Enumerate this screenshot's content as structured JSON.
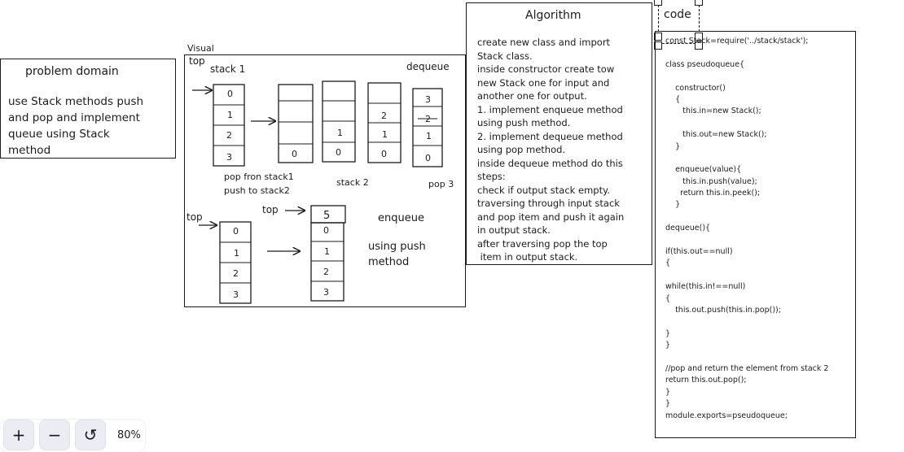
{
  "problem_domain": {
    "title": "problem domain",
    "lines": [
      "use Stack methods push",
      "and pop and implement",
      "queue using Stack",
      "method"
    ]
  },
  "visual": {
    "label": "Visual",
    "top_label": "top",
    "stack1_label": "stack 1",
    "dequeue_label": "dequeue",
    "stack1": [
      "0",
      "1",
      "2",
      "3"
    ],
    "stack_b": [
      "",
      "",
      "",
      "0"
    ],
    "stack_c": [
      "",
      "",
      "1",
      "0"
    ],
    "stack_d": [
      "",
      "2",
      "1",
      "0"
    ],
    "stack_e": [
      "3",
      "2",
      "1",
      "0"
    ],
    "caption_pop": "pop fron stack1",
    "caption_push": "push to stack2",
    "caption_stack2": "stack 2",
    "caption_pop3": "pop 3",
    "bottom_top_label": "top",
    "bottom_top_arrow_label": "top",
    "bottom_left_stack": [
      "0",
      "1",
      "2",
      "3"
    ],
    "bottom_right_top": "5",
    "bottom_right_stack": [
      "0",
      "1",
      "2",
      "3"
    ],
    "enqueue_label": "enqueue",
    "using_push": [
      "using push",
      "method"
    ]
  },
  "algorithm": {
    "title": "Algorithm",
    "lines": [
      "create new class and import",
      "Stack class.",
      "inside constructor create tow",
      "new Stack one for input and",
      "another one for output.",
      "1. implement enqueue method",
      "using push method.",
      "2. implement dequeue method",
      "using pop method.",
      "inside dequeue method do this",
      "steps:",
      "check if output stack empty.",
      "traversing through input stack",
      "and pop item and push it again",
      "in output stack.",
      "after traversing pop the top",
      " item in output stack."
    ]
  },
  "code": {
    "title": "code",
    "lines": [
      "const Stack=require('../stack/stack');",
      "",
      "class pseudoqueue{",
      "",
      "    constructor()",
      "    {",
      "       this.in=new Stack();",
      "",
      "       this.out=new Stack();",
      "    }",
      "",
      "    enqueue(value){",
      "       this.in.push(value);",
      "      return this.in.peek();",
      "    }",
      "",
      "dequeue(){",
      "",
      "if(this.out==null)",
      "{",
      "",
      "while(this.in!==null)",
      "{",
      "    this.out.push(this.in.pop());",
      "",
      "}",
      "}",
      "",
      "//pop and return the element from stack 2",
      "return this.out.pop();",
      "}",
      "}",
      "module.exports=pseudoqueue;"
    ]
  },
  "zoom": {
    "zoom_in": "+",
    "zoom_out": "−",
    "reset": "↺",
    "level": "80%"
  }
}
